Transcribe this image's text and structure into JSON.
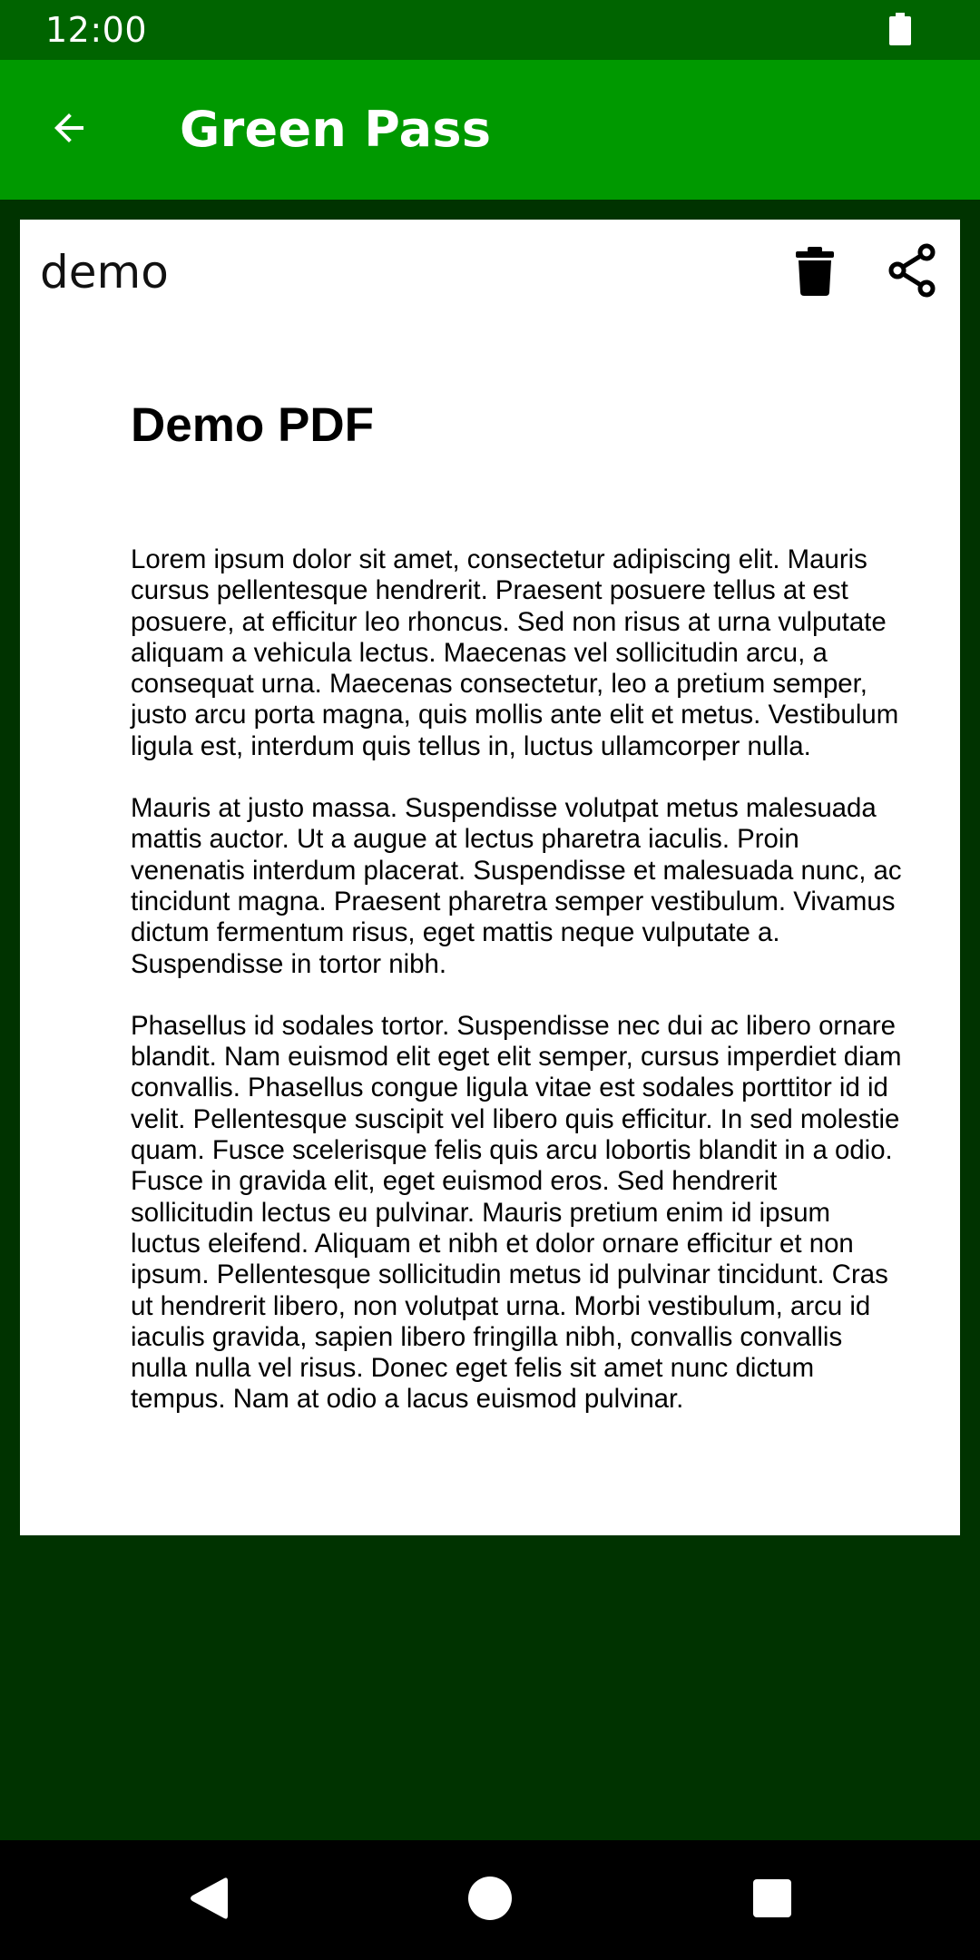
{
  "status_bar": {
    "time": "12:00",
    "battery_icon": "battery-full-icon"
  },
  "app_bar": {
    "back_icon": "arrow-back-icon",
    "title": "Green Pass"
  },
  "card": {
    "name": "demo",
    "delete_icon": "trash-icon",
    "share_icon": "share-icon"
  },
  "pdf": {
    "title": "Demo PDF",
    "paragraphs": [
      "Lorem ipsum dolor sit amet, consectetur adipiscing elit. Mauris cursus pellentesque hendrerit. Praesent posuere tellus at est posuere, at efficitur leo rhoncus. Sed non risus at urna vulputate aliquam a vehicula lectus. Maecenas vel sollicitudin arcu, a consequat urna. Maecenas consectetur, leo a pretium semper, justo arcu porta magna, quis mollis ante elit et metus. Vestibulum ligula est, interdum quis tellus in, luctus ullamcorper nulla.",
      "Mauris at justo massa. Suspendisse volutpat metus malesuada mattis auctor. Ut a augue at lectus pharetra iaculis. Proin venenatis interdum placerat. Suspendisse et malesuada nunc, ac tincidunt magna. Praesent pharetra semper vestibulum. Vivamus dictum fermentum risus, eget mattis neque vulputate a. Suspendisse in tortor nibh.",
      "Phasellus id sodales tortor. Suspendisse nec dui ac libero ornare blandit. Nam euismod elit eget elit semper, cursus imperdiet diam convallis. Phasellus congue ligula vitae est sodales porttitor id id velit. Pellentesque suscipit vel libero quis efficitur. In sed molestie quam. Fusce scelerisque felis quis arcu lobortis blandit in a odio. Fusce in gravida elit, eget euismod eros. Sed hendrerit sollicitudin lectus eu pulvinar. Mauris pretium enim id ipsum luctus eleifend. Aliquam et nibh et dolor ornare efficitur et non ipsum. Pellentesque sollicitudin metus id pulvinar tincidunt. Cras ut hendrerit libero, non volutpat urna. Morbi vestibulum, arcu id iaculis gravida, sapien libero fringilla nibh, convallis convallis nulla nulla vel risus. Donec eget felis sit amet nunc dictum tempus. Nam at odio a lacus euismod pulvinar."
    ]
  },
  "nav_bar": {
    "back_icon": "nav-back-triangle-icon",
    "home_icon": "nav-home-circle-icon",
    "recents_icon": "nav-recents-square-icon"
  },
  "colors": {
    "status_bar_bg": "#006400",
    "app_bar_bg": "#009900",
    "page_bg": "#003300",
    "card_bg": "#ffffff"
  }
}
